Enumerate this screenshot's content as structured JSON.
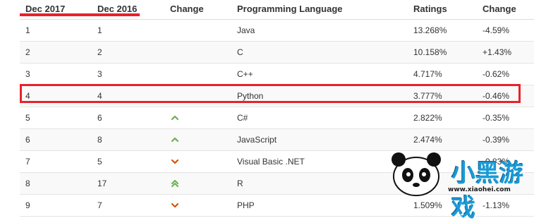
{
  "header": {
    "columns": [
      "Dec 2017",
      "Dec 2016",
      "Change",
      "Programming Language",
      "Ratings",
      "Change"
    ]
  },
  "rows": [
    {
      "rank_2017": "1",
      "rank_2016": "1",
      "trend_icon": "",
      "language": "Java",
      "rating": "13.268%",
      "change": "-4.59%"
    },
    {
      "rank_2017": "2",
      "rank_2016": "2",
      "trend_icon": "",
      "language": "C",
      "rating": "10.158%",
      "change": "+1.43%"
    },
    {
      "rank_2017": "3",
      "rank_2016": "3",
      "trend_icon": "",
      "language": "C++",
      "rating": "4.717%",
      "change": "-0.62%"
    },
    {
      "rank_2017": "4",
      "rank_2016": "4",
      "trend_icon": "",
      "language": "Python",
      "rating": "3.777%",
      "change": "-0.46%"
    },
    {
      "rank_2017": "5",
      "rank_2016": "6",
      "trend_icon": "chevron-up-icon",
      "language": "C#",
      "rating": "2.822%",
      "change": "-0.35%"
    },
    {
      "rank_2017": "6",
      "rank_2016": "8",
      "trend_icon": "chevron-up-icon",
      "language": "JavaScript",
      "rating": "2.474%",
      "change": "-0.39%"
    },
    {
      "rank_2017": "7",
      "rank_2016": "5",
      "trend_icon": "chevron-down-icon",
      "language": "Visual Basic .NET",
      "rating": "2",
      "change": "-0.83%"
    },
    {
      "rank_2017": "8",
      "rank_2016": "17",
      "trend_icon": "double-chevron-up-icon",
      "language": "R",
      "rating": "",
      "change": ""
    },
    {
      "rank_2017": "9",
      "rank_2016": "7",
      "trend_icon": "chevron-down-icon",
      "language": "PHP",
      "rating": "1.509%",
      "change": "-1.13%"
    }
  ],
  "colors": {
    "up": "#6ab04c",
    "down": "#d35400",
    "highlight": "#e8212b"
  },
  "watermark": {
    "brand": "小黑游戏",
    "site": "www.xiaohei.com"
  }
}
